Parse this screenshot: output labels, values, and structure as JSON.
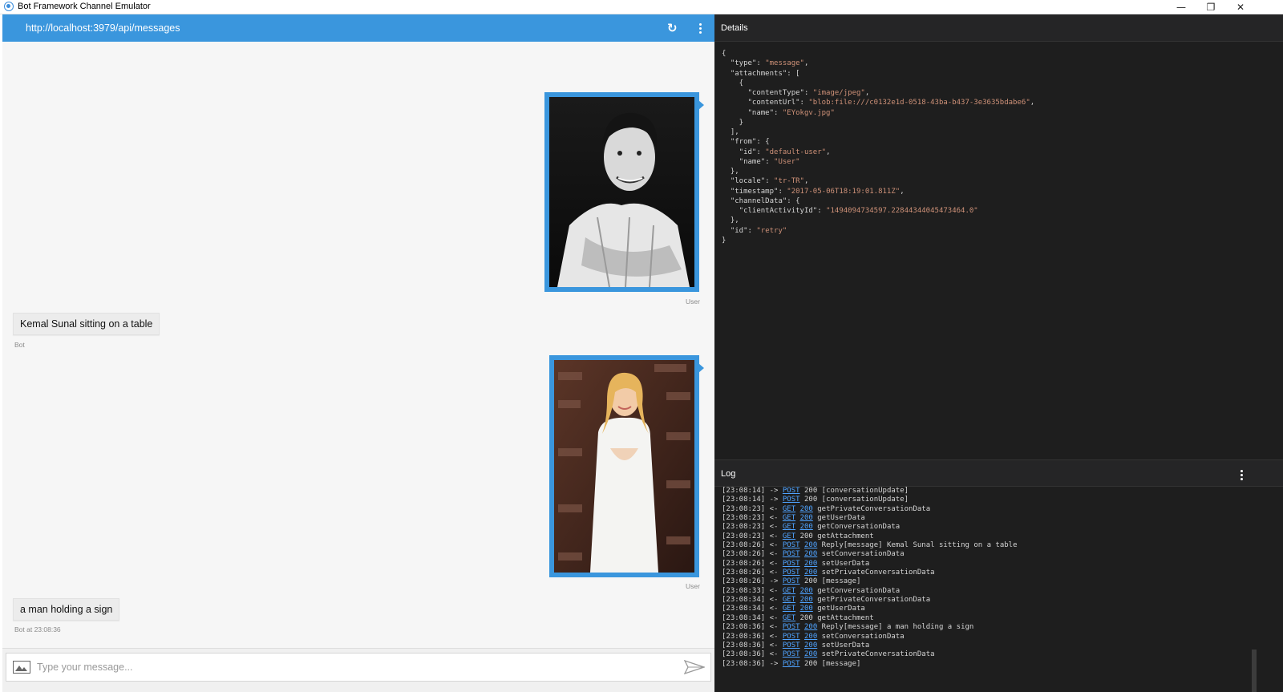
{
  "window": {
    "title": "Bot Framework Channel Emulator",
    "controls": {
      "minimize": "—",
      "restore": "❐",
      "close": "✕"
    }
  },
  "chat": {
    "url": "http://localhost:3979/api/messages",
    "messages": [
      {
        "kind": "image",
        "from": "user",
        "meta": "User"
      },
      {
        "kind": "text",
        "from": "bot",
        "text": "Kemal Sunal sitting on a table",
        "meta": "Bot"
      },
      {
        "kind": "image",
        "from": "user",
        "meta": "User"
      },
      {
        "kind": "text",
        "from": "bot",
        "text": "a man holding a sign",
        "meta": "Bot at 23:08:36"
      }
    ],
    "composer": {
      "placeholder": "Type your message..."
    }
  },
  "details": {
    "title": "Details",
    "json_lines": [
      [
        {
          "t": "{"
        }
      ],
      [
        {
          "t": "  \"type\"",
          "c": "k"
        },
        {
          "t": ": "
        },
        {
          "t": "\"message\"",
          "c": "s"
        },
        {
          "t": ","
        }
      ],
      [
        {
          "t": "  \"attachments\"",
          "c": "k"
        },
        {
          "t": ": ["
        }
      ],
      [
        {
          "t": "    {"
        }
      ],
      [
        {
          "t": "      \"contentType\"",
          "c": "k"
        },
        {
          "t": ": "
        },
        {
          "t": "\"image/jpeg\"",
          "c": "s"
        },
        {
          "t": ","
        }
      ],
      [
        {
          "t": "      \"contentUrl\"",
          "c": "k"
        },
        {
          "t": ": "
        },
        {
          "t": "\"blob:file:///c0132e1d-0518-43ba-b437-3e3635bdabe6\"",
          "c": "s"
        },
        {
          "t": ","
        }
      ],
      [
        {
          "t": "      \"name\"",
          "c": "k"
        },
        {
          "t": ": "
        },
        {
          "t": "\"EYokgv.jpg\"",
          "c": "s"
        }
      ],
      [
        {
          "t": "    }"
        }
      ],
      [
        {
          "t": "  ],"
        }
      ],
      [
        {
          "t": "  \"from\"",
          "c": "k"
        },
        {
          "t": ": {"
        }
      ],
      [
        {
          "t": "    \"id\"",
          "c": "k"
        },
        {
          "t": ": "
        },
        {
          "t": "\"default-user\"",
          "c": "s"
        },
        {
          "t": ","
        }
      ],
      [
        {
          "t": "    \"name\"",
          "c": "k"
        },
        {
          "t": ": "
        },
        {
          "t": "\"User\"",
          "c": "s"
        }
      ],
      [
        {
          "t": "  },"
        }
      ],
      [
        {
          "t": "  \"locale\"",
          "c": "k"
        },
        {
          "t": ": "
        },
        {
          "t": "\"tr-TR\"",
          "c": "s"
        },
        {
          "t": ","
        }
      ],
      [
        {
          "t": "  \"timestamp\"",
          "c": "k"
        },
        {
          "t": ": "
        },
        {
          "t": "\"2017-05-06T18:19:01.811Z\"",
          "c": "s"
        },
        {
          "t": ","
        }
      ],
      [
        {
          "t": "  \"channelData\"",
          "c": "k"
        },
        {
          "t": ": {"
        }
      ],
      [
        {
          "t": "    \"clientActivityId\"",
          "c": "k"
        },
        {
          "t": ": "
        },
        {
          "t": "\"1494094734597.22844344045473464.0\"",
          "c": "s"
        }
      ],
      [
        {
          "t": "  },"
        }
      ],
      [
        {
          "t": "  \"id\"",
          "c": "k"
        },
        {
          "t": ": "
        },
        {
          "t": "\"retry\"",
          "c": "s"
        }
      ],
      [
        {
          "t": "}"
        }
      ]
    ]
  },
  "log": {
    "title": "Log",
    "entries": [
      {
        "time": "[23:08:14]",
        "dir": "->",
        "method": "POST",
        "status": "200",
        "status_link": false,
        "text": "[conversationUpdate]"
      },
      {
        "time": "[23:08:14]",
        "dir": "->",
        "method": "POST",
        "status": "200",
        "status_link": false,
        "text": "[conversationUpdate]"
      },
      {
        "time": "[23:08:23]",
        "dir": "<-",
        "method": "GET",
        "status": "200",
        "status_link": true,
        "text": "getPrivateConversationData"
      },
      {
        "time": "[23:08:23]",
        "dir": "<-",
        "method": "GET",
        "status": "200",
        "status_link": true,
        "text": "getUserData"
      },
      {
        "time": "[23:08:23]",
        "dir": "<-",
        "method": "GET",
        "status": "200",
        "status_link": true,
        "text": "getConversationData"
      },
      {
        "time": "[23:08:23]",
        "dir": "<-",
        "method": "GET",
        "status": "200",
        "status_link": false,
        "text": "getAttachment"
      },
      {
        "time": "[23:08:26]",
        "dir": "<-",
        "method": "POST",
        "status": "200",
        "status_link": true,
        "text": "Reply[message] Kemal Sunal sitting on a table"
      },
      {
        "time": "[23:08:26]",
        "dir": "<-",
        "method": "POST",
        "status": "200",
        "status_link": true,
        "text": "setConversationData"
      },
      {
        "time": "[23:08:26]",
        "dir": "<-",
        "method": "POST",
        "status": "200",
        "status_link": true,
        "text": "setUserData"
      },
      {
        "time": "[23:08:26]",
        "dir": "<-",
        "method": "POST",
        "status": "200",
        "status_link": true,
        "text": "setPrivateConversationData"
      },
      {
        "time": "[23:08:26]",
        "dir": "->",
        "method": "POST",
        "status": "200",
        "status_link": false,
        "text": "[message]"
      },
      {
        "time": "[23:08:33]",
        "dir": "<-",
        "method": "GET",
        "status": "200",
        "status_link": true,
        "text": "getConversationData"
      },
      {
        "time": "[23:08:34]",
        "dir": "<-",
        "method": "GET",
        "status": "200",
        "status_link": true,
        "text": "getPrivateConversationData"
      },
      {
        "time": "[23:08:34]",
        "dir": "<-",
        "method": "GET",
        "status": "200",
        "status_link": true,
        "text": "getUserData"
      },
      {
        "time": "[23:08:34]",
        "dir": "<-",
        "method": "GET",
        "status": "200",
        "status_link": false,
        "text": "getAttachment"
      },
      {
        "time": "[23:08:36]",
        "dir": "<-",
        "method": "POST",
        "status": "200",
        "status_link": true,
        "text": "Reply[message] a man holding a sign"
      },
      {
        "time": "[23:08:36]",
        "dir": "<-",
        "method": "POST",
        "status": "200",
        "status_link": true,
        "text": "setConversationData"
      },
      {
        "time": "[23:08:36]",
        "dir": "<-",
        "method": "POST",
        "status": "200",
        "status_link": true,
        "text": "setUserData"
      },
      {
        "time": "[23:08:36]",
        "dir": "<-",
        "method": "POST",
        "status": "200",
        "status_link": true,
        "text": "setPrivateConversationData"
      },
      {
        "time": "[23:08:36]",
        "dir": "->",
        "method": "POST",
        "status": "200",
        "status_link": false,
        "text": "[message]"
      }
    ]
  },
  "colors": {
    "accent": "#3a96dd",
    "panel_bg": "#1e1e1e",
    "json_string": "#ce9178",
    "log_link": "#4fa3ff"
  },
  "icons": {
    "refresh": "refresh-icon",
    "more": "more-vertical-icon",
    "image": "image-icon",
    "send": "send-icon"
  }
}
